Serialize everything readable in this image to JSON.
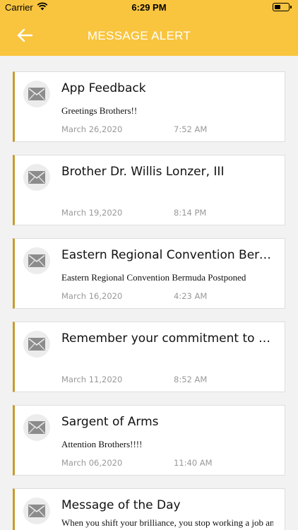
{
  "status_bar": {
    "carrier": "Carrier",
    "time": "6:29 PM"
  },
  "header": {
    "title": "MESSAGE ALERT",
    "back_icon": "arrow-left-icon",
    "bg_color": "#f9c53f"
  },
  "accent_color": "#c89b2d",
  "messages": [
    {
      "title": "App Feedback",
      "body": "Greetings Brothers!!",
      "date": "March 26,2020",
      "time": "7:52 AM"
    },
    {
      "title": "Brother Dr. Willis Lonzer, III",
      "body": "",
      "date": "March 19,2020",
      "time": "8:14 PM"
    },
    {
      "title": "Eastern Regional Convention Bermu...",
      "body": "Eastern Regional Convention Bermuda Postponed",
      "date": "March 16,2020",
      "time": "4:23 AM"
    },
    {
      "title": "Remember your commitment to the...",
      "body": "",
      "date": "March 11,2020",
      "time": "8:52 AM"
    },
    {
      "title": "Sargent of Arms",
      "body": "Attention Brothers!!!!",
      "date": "March 06,2020",
      "time": "11:40 AM"
    },
    {
      "title": "Message of the Day",
      "body": "When you shift your brilliance, you stop working a job and",
      "date": "",
      "time": ""
    }
  ]
}
